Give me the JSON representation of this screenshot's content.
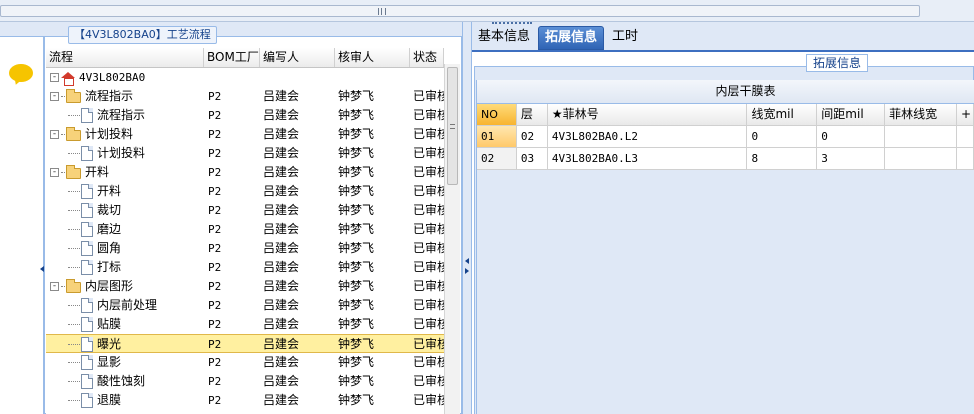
{
  "left_panel": {
    "title": "【4V3L802BA0】工艺流程",
    "columns": [
      "流程",
      "BOM工厂",
      "编写人",
      "核审人",
      "状态"
    ],
    "rows": [
      {
        "label": "4V3L802BA0",
        "kind": "root",
        "level": 0,
        "factory": "",
        "writer": "",
        "reviewer": "",
        "status": ""
      },
      {
        "label": "流程指示",
        "kind": "folder",
        "level": 1,
        "factory": "P2",
        "writer": "吕建会",
        "reviewer": "钟梦飞",
        "status": "已审核"
      },
      {
        "label": "流程指示",
        "kind": "doc",
        "level": 2,
        "factory": "P2",
        "writer": "吕建会",
        "reviewer": "钟梦飞",
        "status": "已审核"
      },
      {
        "label": "计划投料",
        "kind": "folder",
        "level": 1,
        "factory": "P2",
        "writer": "吕建会",
        "reviewer": "钟梦飞",
        "status": "已审核"
      },
      {
        "label": "计划投料",
        "kind": "doc",
        "level": 2,
        "factory": "P2",
        "writer": "吕建会",
        "reviewer": "钟梦飞",
        "status": "已审核"
      },
      {
        "label": "开料",
        "kind": "folder",
        "level": 1,
        "factory": "P2",
        "writer": "吕建会",
        "reviewer": "钟梦飞",
        "status": "已审核"
      },
      {
        "label": "开料",
        "kind": "doc",
        "level": 2,
        "factory": "P2",
        "writer": "吕建会",
        "reviewer": "钟梦飞",
        "status": "已审核"
      },
      {
        "label": "裁切",
        "kind": "doc",
        "level": 2,
        "factory": "P2",
        "writer": "吕建会",
        "reviewer": "钟梦飞",
        "status": "已审核"
      },
      {
        "label": "磨边",
        "kind": "doc",
        "level": 2,
        "factory": "P2",
        "writer": "吕建会",
        "reviewer": "钟梦飞",
        "status": "已审核"
      },
      {
        "label": "圆角",
        "kind": "doc",
        "level": 2,
        "factory": "P2",
        "writer": "吕建会",
        "reviewer": "钟梦飞",
        "status": "已审核"
      },
      {
        "label": "打标",
        "kind": "doc",
        "level": 2,
        "factory": "P2",
        "writer": "吕建会",
        "reviewer": "钟梦飞",
        "status": "已审核"
      },
      {
        "label": "内层图形",
        "kind": "folder",
        "level": 1,
        "factory": "P2",
        "writer": "吕建会",
        "reviewer": "钟梦飞",
        "status": "已审核"
      },
      {
        "label": "内层前处理",
        "kind": "doc",
        "level": 2,
        "factory": "P2",
        "writer": "吕建会",
        "reviewer": "钟梦飞",
        "status": "已审核"
      },
      {
        "label": "贴膜",
        "kind": "doc",
        "level": 2,
        "factory": "P2",
        "writer": "吕建会",
        "reviewer": "钟梦飞",
        "status": "已审核"
      },
      {
        "label": "曝光",
        "kind": "doc",
        "level": 2,
        "factory": "P2",
        "writer": "吕建会",
        "reviewer": "钟梦飞",
        "status": "已审核",
        "selected": true
      },
      {
        "label": "显影",
        "kind": "doc",
        "level": 2,
        "factory": "P2",
        "writer": "吕建会",
        "reviewer": "钟梦飞",
        "status": "已审核"
      },
      {
        "label": "酸性蚀刻",
        "kind": "doc",
        "level": 2,
        "factory": "P2",
        "writer": "吕建会",
        "reviewer": "钟梦飞",
        "status": "已审核"
      },
      {
        "label": "退膜",
        "kind": "doc",
        "level": 2,
        "factory": "P2",
        "writer": "吕建会",
        "reviewer": "钟梦飞",
        "status": "已审核"
      }
    ]
  },
  "right_panel": {
    "tabs": [
      {
        "label": "基本信息",
        "active": false
      },
      {
        "label": "拓展信息",
        "active": true
      },
      {
        "label": "工时",
        "active": false
      }
    ],
    "fieldset_title": "拓展信息",
    "grid_caption": "内层干膜表",
    "grid_columns": [
      "NO",
      "层",
      "★菲林号",
      "线宽mil",
      "间距mil",
      "菲林线宽",
      "+"
    ],
    "grid_rows": [
      [
        "01",
        "02",
        "4V3L802BA0.L2",
        "0",
        "0",
        "",
        ""
      ],
      [
        "02",
        "03",
        "4V3L802BA0.L3",
        "8",
        "3",
        "",
        ""
      ]
    ]
  }
}
